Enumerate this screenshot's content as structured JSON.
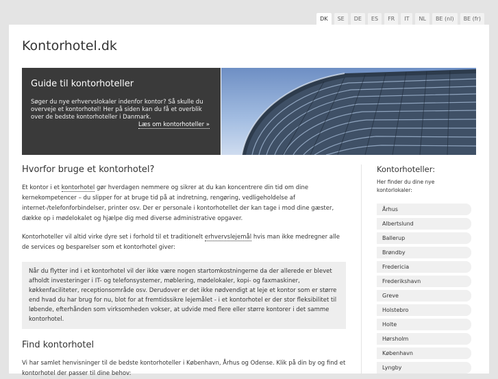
{
  "languages": [
    "DK",
    "SE",
    "DE",
    "ES",
    "FR",
    "IT",
    "NL",
    "BE (nl)",
    "BE (fr)"
  ],
  "site_title": "Kontorhotel.dk",
  "hero": {
    "title": "Guide til kontorhoteller",
    "text": "Søger du nye erhvervslokaler indenfor kontor? Så skulle du overveje et kontorhotel! Her på siden kan du få et overblik over de bedste kontorhoteller i Danmark.",
    "link": "Læs om kontorhoteller »"
  },
  "main": {
    "heading1": "Hvorfor bruge et kontorhotel?",
    "p1_before": "Et kontor i et ",
    "p1_link": "kontorhotel",
    "p1_after": " gør hverdagen nemmere og sikrer at du kan koncentrere din tid om dine kernekompetencer – du slipper for at bruge tid på at indretning, rengøring, vedligeholdelse af internet-/telefonforbindelser, printer osv. Der er personale i kontorhotellet der kan tage i mod dine gæster, dække op i mødelokalet og hjælpe dig med diverse administrative opgaver.",
    "p2_before": "Kontorhoteller vil altid virke dyre set i forhold til et traditionelt ",
    "p2_link": "erhvervslejemål",
    "p2_after": " hvis man ikke medregner alle de services og besparelser som et kontorhotel giver:",
    "quote": "Når du flytter ind i et kontorhotel vil der ikke være nogen startomkostningerne da der allerede er blevet afholdt investeringer i IT- og telefonsystemer, møblering, mødelokaler, kopi- og faxmaskiner, køkkenfaciliteter, receptionsområde osv. Derudover er det ikke nødvendigt at leje et kontor som er større end hvad du har brug for nu, blot for at fremtidssikre lejemålet - i et kontorhotel er der stor fleksibilitet til løbende, efterhånden som virksomheden vokser, at udvide med flere eller større kontorer i det samme kontorhotel.",
    "heading2": "Find kontorhotel",
    "p3": "Vi har samlet henvisninger til de bedste kontorhoteller i København, Århus og Odense. Klik på din by og find et kontorhotel der passer til dine behov:"
  },
  "sidebar": {
    "title": "Kontorhoteller:",
    "intro": "Her finder du dine nye kontorlokaler:",
    "cities": [
      "Århus",
      "Albertslund",
      "Ballerup",
      "Brøndby",
      "Fredericia",
      "Frederikshavn",
      "Greve",
      "Holstebro",
      "Holte",
      "Hørsholm",
      "København",
      "Lyngby"
    ]
  }
}
